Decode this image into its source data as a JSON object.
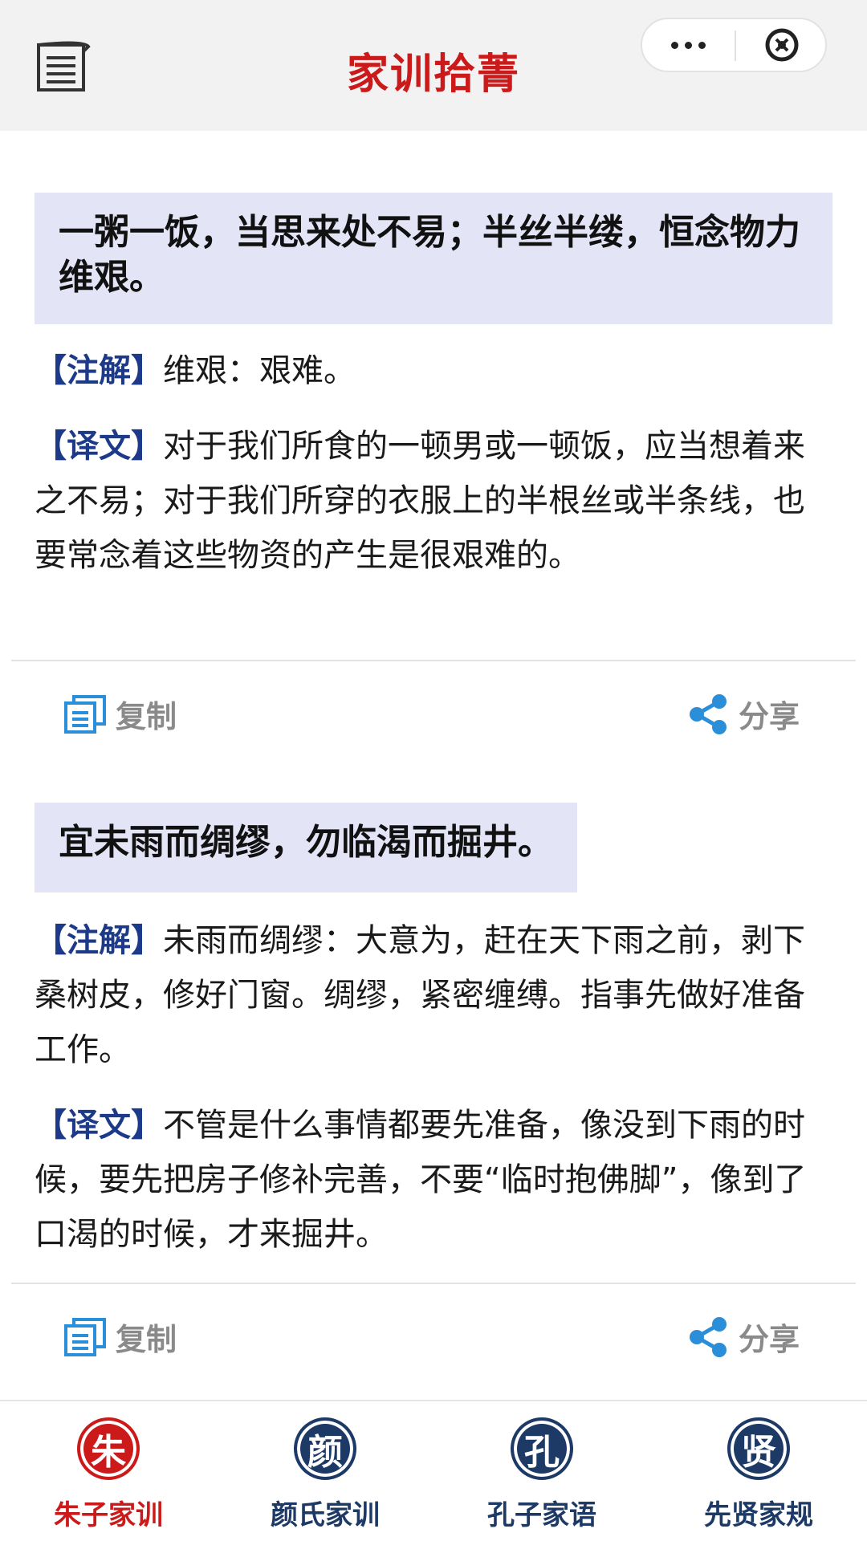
{
  "header": {
    "title": "家训拾菁",
    "menu_icon": "scroll-menu-icon",
    "more_icon": "more-dots-icon",
    "close_icon": "close-circle-icon"
  },
  "cards": [
    {
      "quote": "一粥一饭，当思来处不易；半丝半缕，恒念物力维艰。",
      "note_tag": "【注解】",
      "note": "维艰：艰难。",
      "trans_tag": "【译文】",
      "trans": "对于我们所食的一顿男或一顿饭，应当想着来之不易；对于我们所穿的衣服上的半根丝或半条线，也要常念着这些物资的产生是很艰难的。",
      "copy_label": "复制",
      "share_label": "分享"
    },
    {
      "quote": "宜未雨而绸缪，勿临渴而掘井。",
      "note_tag": "【注解】",
      "note": "未雨而绸缪：大意为，赶在天下雨之前，剥下桑树皮，修好门窗。绸缪，紧密缠缚。指事先做好准备工作。",
      "trans_tag": "【译文】",
      "trans": "不管是什么事情都要先准备，像没到下雨的时候，要先把房子修补完善，不要“临时抱佛脚”，像到了口渴的时候，才来掘井。",
      "copy_label": "复制",
      "share_label": "分享"
    }
  ],
  "nav": {
    "items": [
      {
        "badge": "朱",
        "label": "朱子家训",
        "active": true
      },
      {
        "badge": "颜",
        "label": "颜氏家训",
        "active": false
      },
      {
        "badge": "孔",
        "label": "孔子家语",
        "active": false
      },
      {
        "badge": "贤",
        "label": "先贤家规",
        "active": false
      }
    ]
  },
  "colors": {
    "title_red": "#cc1a1a",
    "tag_blue": "#1d3a8a",
    "quote_bg": "#e4e4f7",
    "icon_blue": "#2a8fd8",
    "nav_dark": "#1d3a66"
  }
}
